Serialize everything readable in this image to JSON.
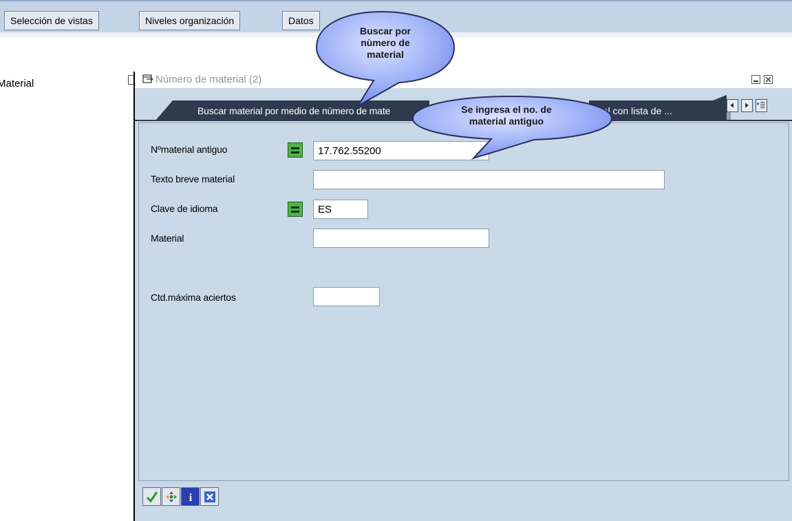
{
  "toolbar": {
    "view_selection": "Selección de vistas",
    "org_levels": "Niveles organización",
    "data": "Datos"
  },
  "background": {
    "material_label": "Material"
  },
  "dialog": {
    "title": "Número de material (2)",
    "tab_active": "Buscar material por medio de número de mate",
    "tab_right": "rial con lista de ...",
    "fields": {
      "old_material_label": "Nºmaterial antiguo",
      "old_material_value": "17.762.55200",
      "short_text_label": "Texto breve material",
      "short_text_value": "",
      "language_label": "Clave de idioma",
      "language_value": "ES",
      "material_label": "Material",
      "material_value": "",
      "max_hits_label": "Ctd.máxima aciertos",
      "max_hits_value": ""
    }
  },
  "callouts": {
    "top": [
      "Buscar por",
      "nùmero de",
      "material"
    ],
    "middle": [
      "Se ingresa el no. de",
      "material antiguo"
    ]
  },
  "colors": {
    "toolbar_bg": "#c3d4e7",
    "dialog_bg": "#c9d9e8",
    "tab_active_bg": "#2f3a4e",
    "callout_fill": "#8fa6f2",
    "equal_button": "#4fb34a"
  }
}
